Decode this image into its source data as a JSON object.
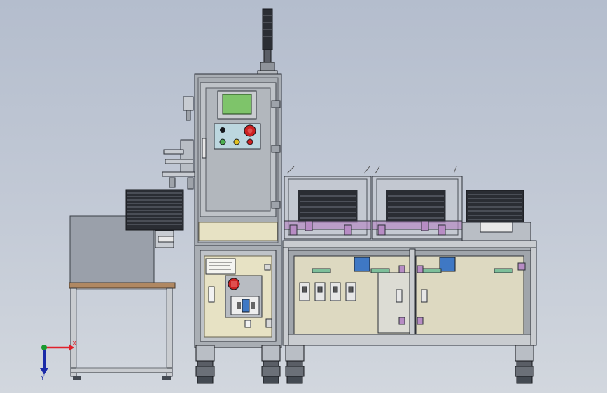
{
  "axis_triad": {
    "x_label": "X",
    "y_label": "Y",
    "x_color": "#e0202a",
    "y_color": "#1a9a30",
    "z_color": "#1a2aa8"
  },
  "colors": {
    "frame_metal": "#a9aeb4",
    "frame_edge": "#2b2f36",
    "beige_panel": "#e7e2c4",
    "screen_green": "#7ec46a",
    "blue_accent": "#3f78c4",
    "purple_clamp": "#b78cc4",
    "green_pad": "#7dbf9a",
    "stop_red": "#cc2222",
    "table_top": "#b08862"
  },
  "components": [
    "signal-tower",
    "control-cabinet",
    "hmi-screen",
    "button-panel",
    "main-switch",
    "left-fixture-arm",
    "left-tray-stack",
    "side-table",
    "left-cover-bay",
    "right-cover-bay",
    "right-tray-stack",
    "lower-machine-frame",
    "leveling-feet"
  ]
}
